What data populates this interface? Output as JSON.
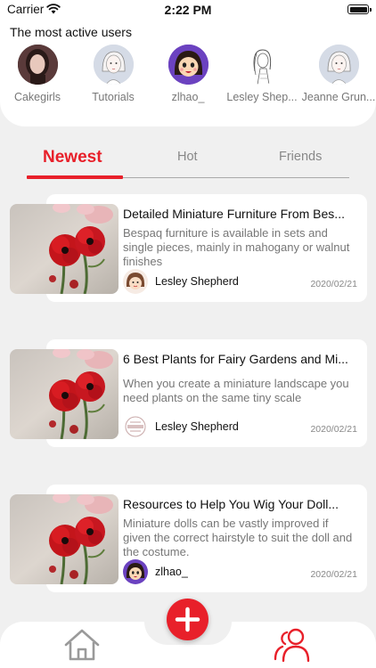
{
  "status_bar": {
    "carrier": "Carrier",
    "time": "2:22 PM"
  },
  "active_users": {
    "title": "The most active users",
    "users": [
      {
        "name": "Cakegirls",
        "avatar": "photo-woman-avatar"
      },
      {
        "name": "Tutorials",
        "avatar": "sketch-girl-avatar"
      },
      {
        "name": "zlhao_",
        "avatar": "cartoon-girl-avatar"
      },
      {
        "name": "Lesley Shep...",
        "avatar": "sketch-woman-avatar"
      },
      {
        "name": "Jeanne Grun...",
        "avatar": "sketch-girl-avatar"
      }
    ]
  },
  "tabs": [
    {
      "label": "Newest",
      "active": true
    },
    {
      "label": "Hot",
      "active": false
    },
    {
      "label": "Friends",
      "active": false
    }
  ],
  "articles": [
    {
      "title": "Detailed Miniature Furniture From Bes...",
      "description": "Bespaq furniture is available in sets and single pieces, mainly in mahogany or walnut finishes",
      "author": "Lesley Shepherd",
      "author_avatar": "cartoon-face-avatar",
      "date": "2020/02/21",
      "thumbnail": "red-flowers-photo"
    },
    {
      "title": "6 Best Plants for Fairy Gardens and Mi...",
      "description": "When you create a miniature landscape you need plants on the same tiny scale",
      "author": "Lesley Shepherd",
      "author_avatar": "logo-badge-avatar",
      "date": "2020/02/21",
      "thumbnail": "red-flowers-photo"
    },
    {
      "title": "Resources to Help You Wig Your Doll...",
      "description": "Miniature dolls can be vastly improved if given the correct hairstyle to suit the doll and the costume.",
      "author": "zlhao_",
      "author_avatar": "cartoon-girl-avatar",
      "date": "2020/02/21",
      "thumbnail": "red-flowers-photo"
    }
  ],
  "bottom_nav": {
    "home_icon": "home-icon",
    "add_icon": "plus-icon",
    "users_icon": "users-icon"
  },
  "colors": {
    "accent": "#e8202a",
    "background": "#f0f0f0",
    "card": "#ffffff",
    "muted_text": "#777777"
  }
}
